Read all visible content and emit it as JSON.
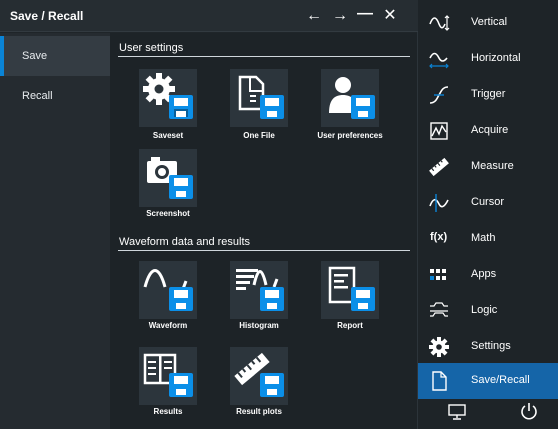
{
  "dialog": {
    "title": "Save / Recall",
    "controls": {
      "back": "←",
      "forward": "→",
      "minimize": "—",
      "close": "✕"
    }
  },
  "sidebar": {
    "items": [
      {
        "label": "Save",
        "active": true
      },
      {
        "label": "Recall",
        "active": false
      }
    ]
  },
  "sections": {
    "user_settings": {
      "title": "User settings",
      "tiles": [
        {
          "label": "Saveset",
          "icon": "gear-save-icon"
        },
        {
          "label": "One File",
          "icon": "file-save-icon"
        },
        {
          "label": "User preferences",
          "icon": "user-save-icon"
        },
        {
          "label": "Screenshot",
          "icon": "camera-save-icon"
        }
      ]
    },
    "waveform": {
      "title": "Waveform data and results",
      "tiles": [
        {
          "label": "Waveform",
          "icon": "waveform-save-icon"
        },
        {
          "label": "Histogram",
          "icon": "histogram-save-icon"
        },
        {
          "label": "Report",
          "icon": "report-save-icon"
        },
        {
          "label": "Results",
          "icon": "results-save-icon"
        },
        {
          "label": "Result plots",
          "icon": "result-plots-save-icon"
        }
      ]
    }
  },
  "menu": {
    "items": [
      {
        "label": "Vertical",
        "icon": "vertical-icon"
      },
      {
        "label": "Horizontal",
        "icon": "horizontal-icon"
      },
      {
        "label": "Trigger",
        "icon": "trigger-icon"
      },
      {
        "label": "Acquire",
        "icon": "acquire-icon"
      },
      {
        "label": "Measure",
        "icon": "measure-icon"
      },
      {
        "label": "Cursor",
        "icon": "cursor-icon"
      },
      {
        "label": "Math",
        "icon": "math-icon",
        "glyph": "f(x)"
      },
      {
        "label": "Apps",
        "icon": "apps-icon"
      },
      {
        "label": "Logic",
        "icon": "logic-icon"
      },
      {
        "label": "Settings",
        "icon": "settings-icon"
      },
      {
        "label": "Save/Recall",
        "icon": "save-recall-icon",
        "active": true
      }
    ],
    "bottom": [
      {
        "name": "display-icon"
      },
      {
        "name": "power-icon"
      }
    ]
  },
  "colors": {
    "accent": "#0a84d6",
    "active_menu": "#1565a8",
    "tile_bg": "#2c353c",
    "disk_blue": "#0b8fe8"
  }
}
